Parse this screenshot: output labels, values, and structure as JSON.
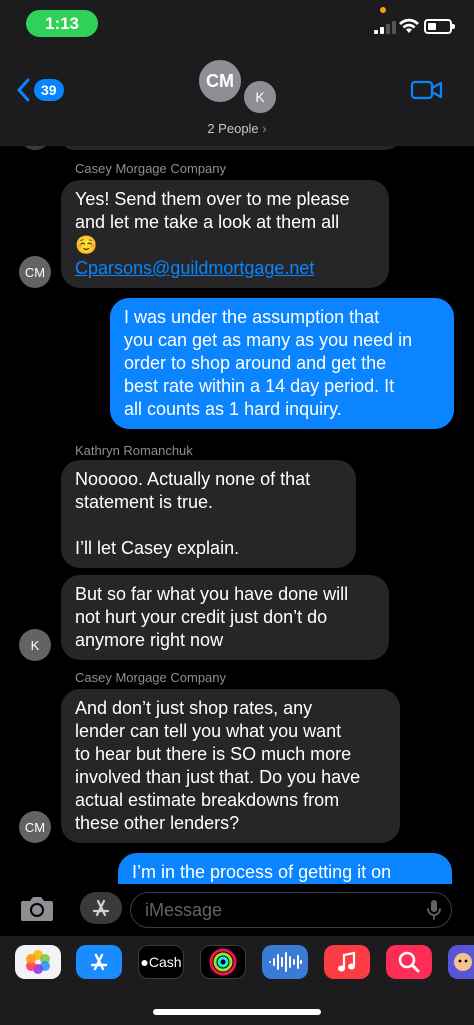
{
  "status_bar": {
    "time": "1:13"
  },
  "header": {
    "back_count": "39",
    "avatar_main": "CM",
    "avatar_second": "K",
    "people_label": "2 People"
  },
  "messages": [
    {
      "type": "sender",
      "text": "Casey  Morgage Company"
    },
    {
      "type": "incoming",
      "lines": [
        "Yes! Send them over to me please",
        "and let me take a look at them all"
      ],
      "emoji": "☺️",
      "link": "Cparsons@guildmortgage.net",
      "avatar": "CM"
    },
    {
      "type": "outgoing",
      "lines": [
        "I was under the assumption that",
        "you can get as many as you need in",
        "order to shop around and get the",
        "best rate within a 14 day period. It",
        "all counts as 1 hard inquiry."
      ]
    },
    {
      "type": "sender",
      "text": "Kathryn Romanchuk"
    },
    {
      "type": "incoming",
      "lines": [
        "Nooooo.  Actually none of that",
        "statement is true.",
        "",
        "I’ll let Casey explain."
      ]
    },
    {
      "type": "incoming",
      "lines": [
        "But so far what you have done will",
        "not hurt your credit just don’t do",
        "anymore right now"
      ],
      "avatar": "K"
    },
    {
      "type": "sender",
      "text": "Casey  Morgage Company"
    },
    {
      "type": "incoming",
      "lines": [
        "And don’t just shop rates, any",
        "lender can tell you what you want",
        "to hear but there is SO much more",
        "involved than just that. Do you have",
        "actual estimate breakdowns from",
        "these other lenders?"
      ],
      "avatar": "CM"
    },
    {
      "type": "outgoing",
      "lines": [
        "I’m in the process of getting it on"
      ]
    }
  ],
  "input": {
    "placeholder": "iMessage"
  },
  "apps": [
    {
      "name": "photos-icon"
    },
    {
      "name": "app-store-icon"
    },
    {
      "name": "apple-cash-icon",
      "label": "Cash"
    },
    {
      "name": "activity-icon"
    },
    {
      "name": "audio-message-icon"
    },
    {
      "name": "music-icon"
    },
    {
      "name": "search-images-icon"
    },
    {
      "name": "memoji-icon"
    }
  ],
  "colors": {
    "accent": "#0a84ff",
    "incoming_bubble": "#262628",
    "time_pill": "#30d158"
  }
}
